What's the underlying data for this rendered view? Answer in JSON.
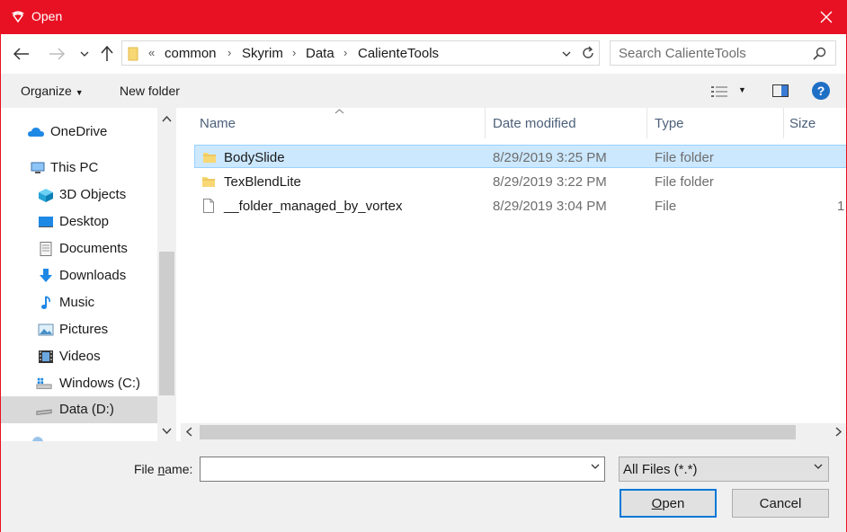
{
  "window": {
    "title": "Open",
    "accent_color": "#e81123"
  },
  "address": {
    "overflow_glyph": "«",
    "crumbs": [
      "common",
      "Skyrim",
      "Data",
      "CalienteTools"
    ]
  },
  "search": {
    "placeholder": "Search CalienteTools"
  },
  "toolbar": {
    "organize": "Organize",
    "new_folder": "New folder"
  },
  "nav": {
    "items": [
      {
        "label": "OneDrive",
        "icon": "cloud-icon"
      },
      {
        "label": "This PC",
        "icon": "computer-icon"
      },
      {
        "label": "3D Objects",
        "icon": "cube-icon"
      },
      {
        "label": "Desktop",
        "icon": "desktop-icon"
      },
      {
        "label": "Documents",
        "icon": "documents-icon"
      },
      {
        "label": "Downloads",
        "icon": "download-arrow-icon"
      },
      {
        "label": "Music",
        "icon": "music-note-icon"
      },
      {
        "label": "Pictures",
        "icon": "pictures-icon"
      },
      {
        "label": "Videos",
        "icon": "film-icon"
      },
      {
        "label": "Windows (C:)",
        "icon": "windows-drive-icon"
      },
      {
        "label": "Data (D:)",
        "icon": "drive-icon"
      }
    ],
    "selected": "Data (D:)"
  },
  "columns": {
    "name": "Name",
    "date": "Date modified",
    "type": "Type",
    "size": "Size"
  },
  "files": [
    {
      "name": "BodySlide",
      "date": "8/29/2019 3:25 PM",
      "type": "File folder",
      "size": "",
      "icon": "folder-icon"
    },
    {
      "name": "TexBlendLite",
      "date": "8/29/2019 3:22 PM",
      "type": "File folder",
      "size": "",
      "icon": "folder-icon"
    },
    {
      "name": "__folder_managed_by_vortex",
      "date": "8/29/2019 3:04 PM",
      "type": "File",
      "size": "1",
      "icon": "file-icon"
    }
  ],
  "bottom": {
    "file_name_label_pre": "File ",
    "file_name_label_u": "n",
    "file_name_label_post": "ame:",
    "file_name_value": "",
    "filter": "All Files (*.*)",
    "open_u": "O",
    "open_rest": "pen",
    "cancel": "Cancel"
  }
}
